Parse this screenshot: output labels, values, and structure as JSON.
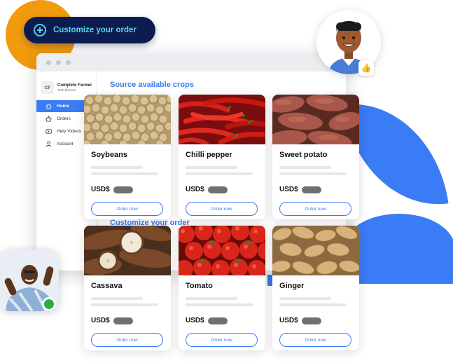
{
  "promo": {
    "customize_label": "Customize your order"
  },
  "sidebar": {
    "brand_initials": "CF",
    "brand_name": "Complete Farmer",
    "brand_sub": "Tech Division",
    "items": [
      {
        "label": "Home",
        "icon": "home-icon",
        "active": true
      },
      {
        "label": "Orders",
        "icon": "basket-icon",
        "active": false
      },
      {
        "label": "Help Videos",
        "icon": "video-icon",
        "active": false
      },
      {
        "label": "Account",
        "icon": "user-icon",
        "active": false
      }
    ]
  },
  "main": {
    "section_title": "Source available crops",
    "customize_title": "Customize your order",
    "currency": "USD$",
    "order_label": "Order now",
    "products": [
      {
        "name": "Soybeans"
      },
      {
        "name": "Chilli pepper"
      },
      {
        "name": "Sweet potato"
      },
      {
        "name": "Cassava"
      },
      {
        "name": "Tomato"
      },
      {
        "name": "Ginger"
      }
    ]
  },
  "colors": {
    "accent": "#3a7bf6",
    "navy": "#0c1c50",
    "orange": "#f29a0e",
    "online": "#27ae45"
  },
  "icons": {
    "like": "thumbs-up-icon",
    "plus": "plus-circle-icon"
  }
}
